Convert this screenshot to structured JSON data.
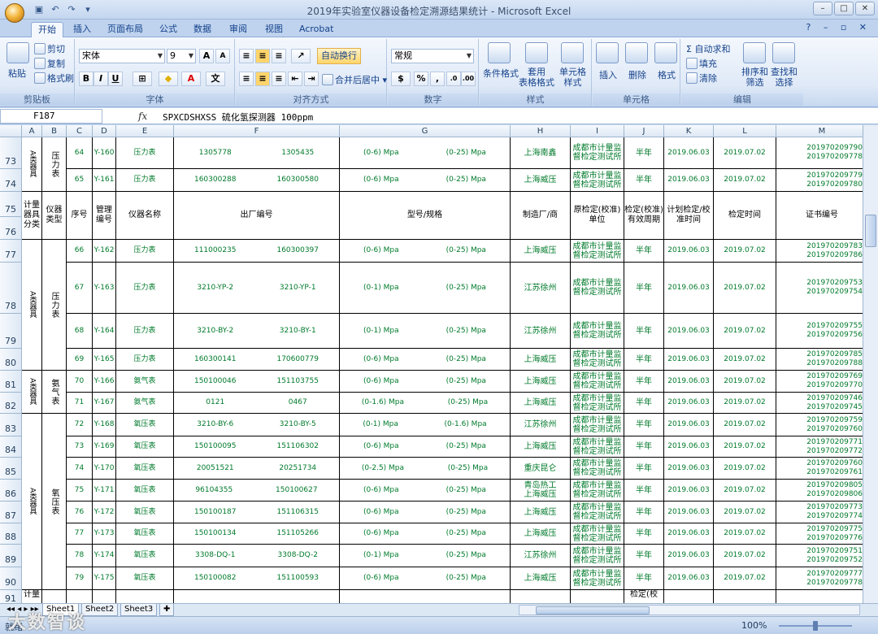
{
  "window": {
    "title": "2019年实验室仪器设备检定溯源结果统计 - Microsoft Excel"
  },
  "tabs": [
    "开始",
    "插入",
    "页面布局",
    "公式",
    "数据",
    "审阅",
    "视图",
    "Acrobat"
  ],
  "active_tab": "开始",
  "ribbon": {
    "clipboard": {
      "paste": "粘贴",
      "cut": "剪切",
      "copy": "复制",
      "format_painter": "格式刷",
      "label": "剪贴板"
    },
    "font": {
      "name": "宋体",
      "size": "9",
      "label": "字体",
      "bold": "B",
      "italic": "I",
      "underline": "U",
      "grow": "A",
      "shrink": "A"
    },
    "alignment": {
      "wrap": "自动换行",
      "merge": "合并后居中",
      "label": "对齐方式"
    },
    "number": {
      "format": "常规",
      "percent": "%",
      "comma": ",",
      "label": "数字"
    },
    "styles": {
      "conditional": "条件格式",
      "table": "套用\n表格格式",
      "cell": "单元格\n样式",
      "label": "样式"
    },
    "cells": {
      "insert": "插入",
      "delete": "删除",
      "format": "格式",
      "label": "单元格"
    },
    "editing": {
      "autosum": "自动求和",
      "fill": "填充",
      "clear": "清除",
      "sort": "排序和\n筛选",
      "find": "查找和\n选择",
      "label": "编辑"
    }
  },
  "formula_bar": {
    "name_box": "F187",
    "fx": "fx",
    "content": "SPXCDSHXSS 硫化氢探测器 100ppm"
  },
  "columns": [
    "A",
    "B",
    "C",
    "D",
    "E",
    "F",
    "G",
    "H",
    "I",
    "J",
    "K",
    "L",
    "M"
  ],
  "header_row": {
    "a": "计量器具分类",
    "b": "仪器类型",
    "c": "序号",
    "d": "管理编号",
    "e": "仪器名称",
    "f": "出厂编号",
    "g": "型号/规格",
    "h": "制造厂/商",
    "i": "原检定(校准)单位",
    "j": "检定(校准)有效周期",
    "k": "计划检定/校准时间",
    "l": "检定时间",
    "m": "证书编号"
  },
  "group_labels": {
    "a_class": "A类器具",
    "pressure": "压力表",
    "ammonia": "氨气表",
    "oxygen": "氧压表"
  },
  "rows": [
    {
      "row": "73",
      "seq": "64",
      "mgmt": "Y-160",
      "name": "压力表",
      "f1": "1305778",
      "f2": "1305435",
      "g1": "(0-6) Mpa",
      "g2": "(0-25) Mpa",
      "maker": "上海南鑫",
      "unit": "成都市计量监督检定测试所",
      "period": "半年",
      "plan": "2019.06.03",
      "date": "2019.07.02",
      "cert1": "201970209790",
      "cert2": "201970209778"
    },
    {
      "row": "74",
      "seq": "65",
      "mgmt": "Y-161",
      "name": "压力表",
      "f1": "160300288",
      "f2": "160300580",
      "g1": "(0-6) Mpa",
      "g2": "(0-25) Mpa",
      "maker": "上海威压",
      "unit": "成都市计量监督检定测试所",
      "period": "半年",
      "plan": "2019.06.03",
      "date": "2019.07.02",
      "cert1": "201970209779",
      "cert2": "201970209780"
    },
    {
      "row": "77",
      "seq": "66",
      "mgmt": "Y-162",
      "name": "压力表",
      "f1": "111000235",
      "f2": "160300397",
      "g1": "(0-6) Mpa",
      "g2": "(0-25) Mpa",
      "maker": "上海威压",
      "unit": "成都市计量监督检定测试所",
      "period": "半年",
      "plan": "2019.06.03",
      "date": "2019.07.02",
      "cert1": "201970209783",
      "cert2": "201970209786"
    },
    {
      "row": "78",
      "seq": "67",
      "mgmt": "Y-163",
      "name": "压力表",
      "f1": "3210-YP-2",
      "f2": "3210-YP-1",
      "g1": "(0-1) Mpa",
      "g2": "(0-25) Mpa",
      "maker": "江苏徐州",
      "unit": "成都市计量监督检定测试所",
      "period": "半年",
      "plan": "2019.06.03",
      "date": "2019.07.02",
      "cert1": "201970209753",
      "cert2": "201970209754"
    },
    {
      "row": "79",
      "seq": "68",
      "mgmt": "Y-164",
      "name": "压力表",
      "f1": "3210-BY-2",
      "f2": "3210-BY-1",
      "g1": "(0-1) Mpa",
      "g2": "(0-25) Mpa",
      "maker": "江苏徐州",
      "unit": "成都市计量监督检定测试所",
      "period": "半年",
      "plan": "2019.06.03",
      "date": "2019.07.02",
      "cert1": "201970209755",
      "cert2": "201970209756"
    },
    {
      "row": "80",
      "seq": "69",
      "mgmt": "Y-165",
      "name": "压力表",
      "f1": "160300141",
      "f2": "170600779",
      "g1": "(0-6) Mpa",
      "g2": "(0-25) Mpa",
      "maker": "上海威压",
      "unit": "成都市计量监督检定测试所",
      "period": "半年",
      "plan": "2019.06.03",
      "date": "2019.07.02",
      "cert1": "201970209785",
      "cert2": "201970209788"
    },
    {
      "row": "81",
      "seq": "70",
      "mgmt": "Y-166",
      "name": "氨气表",
      "f1": "150100046",
      "f2": "151103755",
      "g1": "(0-6) Mpa",
      "g2": "(0-25) Mpa",
      "maker": "上海威压",
      "unit": "成都市计量监督检定测试所",
      "period": "半年",
      "plan": "2019.06.03",
      "date": "2019.07.02",
      "cert1": "201970209769",
      "cert2": "201970209770"
    },
    {
      "row": "82",
      "seq": "71",
      "mgmt": "Y-167",
      "name": "氨气表",
      "f1": "0121",
      "f2": "0467",
      "g1": "(0-1.6) Mpa",
      "g2": "(0-25) Mpa",
      "maker": "上海威压",
      "unit": "成都市计量监督检定测试所",
      "period": "半年",
      "plan": "2019.06.03",
      "date": "2019.07.02",
      "cert1": "201970209746",
      "cert2": "201970209745"
    },
    {
      "row": "83",
      "seq": "72",
      "mgmt": "Y-168",
      "name": "氧压表",
      "f1": "3210-BY-6",
      "f2": "3210-BY-5",
      "g1": "(0-1) Mpa",
      "g2": "(0-1.6) Mpa",
      "maker": "江苏徐州",
      "unit": "成都市计量监督检定测试所",
      "period": "半年",
      "plan": "2019.06.03",
      "date": "2019.07.02",
      "cert1": "201970209759",
      "cert2": "201970209760"
    },
    {
      "row": "84",
      "seq": "73",
      "mgmt": "Y-169",
      "name": "氧压表",
      "f1": "150100095",
      "f2": "151106302",
      "g1": "(0-6) Mpa",
      "g2": "(0-25) Mpa",
      "maker": "上海威压",
      "unit": "成都市计量监督检定测试所",
      "period": "半年",
      "plan": "2019.06.03",
      "date": "2019.07.02",
      "cert1": "201970209771",
      "cert2": "201970209772"
    },
    {
      "row": "85",
      "seq": "74",
      "mgmt": "Y-170",
      "name": "氧压表",
      "f1": "20051521",
      "f2": "20251734",
      "g1": "(0-2.5) Mpa",
      "g2": "(0-25) Mpa",
      "maker": "重庆昆仑",
      "unit": "成都市计量监督检定测试所",
      "period": "半年",
      "plan": "2019.06.03",
      "date": "2019.07.02",
      "cert1": "201970209760",
      "cert2": "201970209761"
    },
    {
      "row": "86",
      "seq": "75",
      "mgmt": "Y-171",
      "name": "氧压表",
      "f1": "96104355",
      "f2": "150100627",
      "g1": "(0-6) Mpa",
      "g2": "(0-25) Mpa",
      "maker": "青岛热工上海威压",
      "unit": "成都市计量监督检定测试所",
      "period": "半年",
      "plan": "2019.06.03",
      "date": "2019.07.02",
      "cert1": "201970209805",
      "cert2": "201970209806"
    },
    {
      "row": "87",
      "seq": "76",
      "mgmt": "Y-172",
      "name": "氧压表",
      "f1": "150100187",
      "f2": "151106315",
      "g1": "(0-6) Mpa",
      "g2": "(0-25) Mpa",
      "maker": "上海威压",
      "unit": "成都市计量监督检定测试所",
      "period": "半年",
      "plan": "2019.06.03",
      "date": "2019.07.02",
      "cert1": "201970209773",
      "cert2": "201970209774"
    },
    {
      "row": "88",
      "seq": "77",
      "mgmt": "Y-173",
      "name": "氧压表",
      "f1": "150100134",
      "f2": "151105266",
      "g1": "(0-6) Mpa",
      "g2": "(0-25) Mpa",
      "maker": "上海威压",
      "unit": "成都市计量监督检定测试所",
      "period": "半年",
      "plan": "2019.06.03",
      "date": "2019.07.02",
      "cert1": "201970209775",
      "cert2": "201970209776"
    },
    {
      "row": "89",
      "seq": "78",
      "mgmt": "Y-174",
      "name": "氧压表",
      "f1": "3308-DQ-1",
      "f2": "3308-DQ-2",
      "g1": "(0-1) Mpa",
      "g2": "(0-25) Mpa",
      "maker": "江苏徐州",
      "unit": "成都市计量监督检定测试所",
      "period": "半年",
      "plan": "2019.06.03",
      "date": "2019.07.02",
      "cert1": "201970209751",
      "cert2": "201970209752"
    },
    {
      "row": "90",
      "seq": "79",
      "mgmt": "Y-175",
      "name": "氧压表",
      "f1": "150100082",
      "f2": "151100593",
      "g1": "(0-6) Mpa",
      "g2": "(0-25) Mpa",
      "maker": "上海威压",
      "unit": "成都市计量监督检定测试所",
      "period": "半年",
      "plan": "2019.06.03",
      "date": "2019.07.02",
      "cert1": "201970209777",
      "cert2": "201970209778"
    }
  ],
  "partial_row": {
    "row": "91",
    "a": "计量",
    "j": "检定(校"
  },
  "sheets": [
    "Sheet1",
    "Sheet2",
    "Sheet3"
  ],
  "status": {
    "ready": "就绪",
    "zoom": "100%"
  },
  "watermark": "大数智谈"
}
